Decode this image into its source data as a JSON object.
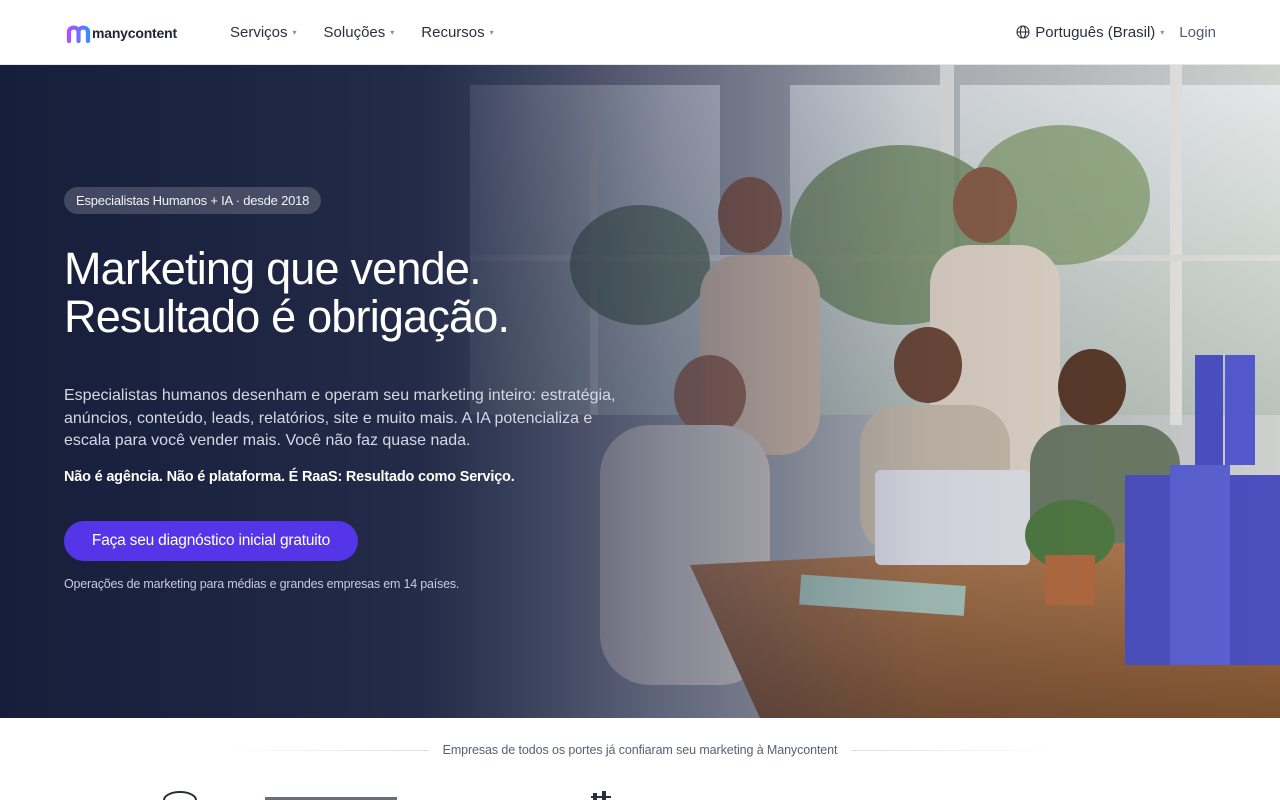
{
  "brand": {
    "name": "manycontent",
    "colors": {
      "accent": "#5535e8",
      "logo_gradient_start": "#b44dff",
      "logo_gradient_end": "#3a8bff",
      "nav_text": "#2b3040"
    }
  },
  "nav": {
    "items": [
      {
        "label": "Serviços",
        "caret": "▾"
      },
      {
        "label": "Soluções",
        "caret": "▾"
      },
      {
        "label": "Recursos",
        "caret": "▾"
      }
    ],
    "language": {
      "label": "Português (Brasil)",
      "caret": "▾",
      "icon": "globe-icon"
    },
    "login_label": "Login"
  },
  "hero": {
    "badge": "Especialistas Humanos + IA · desde 2018",
    "title_lines": [
      "Marketing que vende.",
      "Resultado é obrigação."
    ],
    "description": "Especialistas humanos desenham e operam seu marketing inteiro: estratégia, anúncios, conteúdo, leads, relatórios, site e muito mais. A IA potencializa e escala para você vender mais. Você não faz quase nada.",
    "tagline": "Não é agência. Não é plataforma. É RaaS: Resultado como Serviço.",
    "cta_label": "Faça seu diagnóstico inicial gratuito",
    "footnote": "Operações de marketing para médias e grandes empresas em 14 países.",
    "image": "team-laughing-high-five-laptop-photo"
  },
  "trust": {
    "text": "Empresas de todos os portes já confiaram seu marketing à Manycontent"
  }
}
